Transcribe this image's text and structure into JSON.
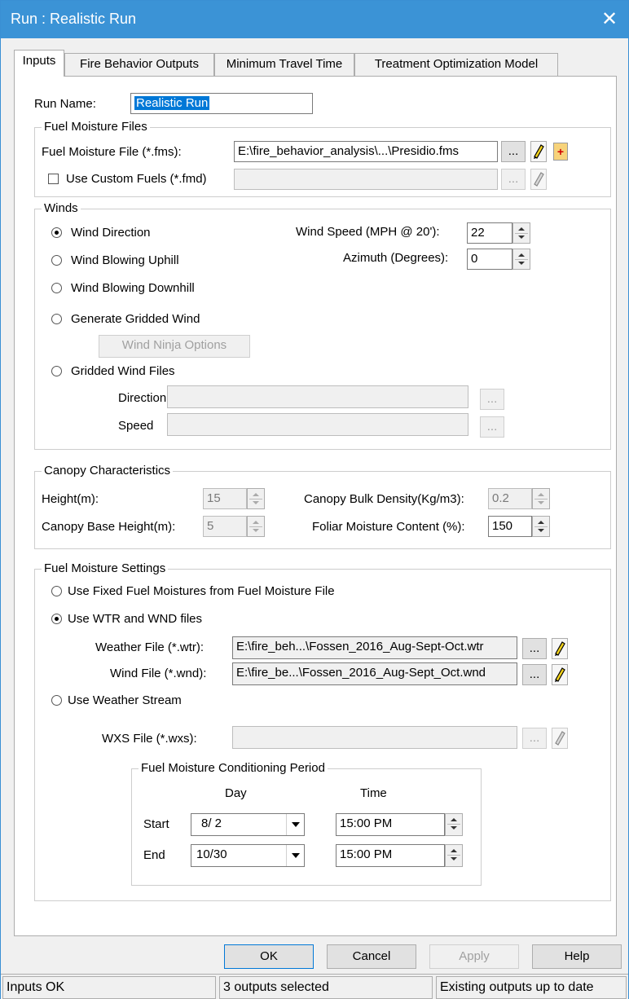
{
  "window": {
    "title": "Run : Realistic Run",
    "close_glyph": "✕"
  },
  "tabs": [
    "Inputs",
    "Fire Behavior Outputs",
    "Minimum Travel Time",
    "Treatment Optimization Model"
  ],
  "run_name": {
    "label": "Run Name:",
    "value": "Realistic Run"
  },
  "fuel_moisture_files": {
    "legend": "Fuel Moisture Files",
    "fms_label": "Fuel Moisture File (*.fms):",
    "fms_value": "E:\\fire_behavior_analysis\\...\\Presidio.fms",
    "custom_label": "Use Custom Fuels (*.fmd)",
    "custom_checked": false,
    "custom_value": "",
    "browse": "..."
  },
  "winds": {
    "legend": "Winds",
    "options": [
      "Wind Direction",
      "Wind Blowing Uphill",
      "Wind Blowing Downhill",
      "Generate Gridded Wind",
      "Gridded Wind Files"
    ],
    "selected": "Wind Direction",
    "speed_label": "Wind Speed (MPH @ 20'):",
    "speed_value": "22",
    "azimuth_label": "Azimuth (Degrees):",
    "azimuth_value": "0",
    "ninja_button": "Wind Ninja Options",
    "direction_label": "Direction",
    "speed_file_label": "Speed",
    "direction_value": "",
    "speed_file_value": ""
  },
  "canopy": {
    "legend": "Canopy Characteristics",
    "height_label": "Height(m):",
    "height_value": "15",
    "base_label": "Canopy Base Height(m):",
    "base_value": "5",
    "density_label": "Canopy Bulk Density(Kg/m3):",
    "density_value": "0.2",
    "foliar_label": "Foliar Moisture Content (%):",
    "foliar_value": "150"
  },
  "fuel_moisture_settings": {
    "legend": "Fuel Moisture Settings",
    "options": [
      "Use Fixed Fuel Moistures from Fuel Moisture File",
      "Use WTR and WND files",
      "Use Weather Stream"
    ],
    "selected": "Use WTR and WND files",
    "wtr_label": "Weather File (*.wtr):",
    "wtr_value": "E:\\fire_beh...\\Fossen_2016_Aug-Sept-Oct.wtr",
    "wnd_label": "Wind File (*.wnd):",
    "wnd_value": "E:\\fire_be...\\Fossen_2016_Aug-Sept_Oct.wnd",
    "wxs_label": "WXS File (*.wxs):",
    "wxs_value": "",
    "conditioning": {
      "legend": "Fuel Moisture Conditioning Period",
      "day_header": "Day",
      "time_header": "Time",
      "start_label": "Start",
      "end_label": "End",
      "start_day": "8/ 2",
      "end_day": "10/30",
      "start_time": "15:00 PM",
      "end_time": "15:00 PM"
    }
  },
  "buttons": {
    "ok": "OK",
    "cancel": "Cancel",
    "apply": "Apply",
    "help": "Help"
  },
  "status": [
    "Inputs OK",
    "3 outputs selected",
    "Existing outputs up to date"
  ],
  "colors": {
    "titlebar": "#3b93d6",
    "selection": "#0078d7",
    "pencil_yellow": "#f2d21b"
  },
  "icons": {
    "browse": "ellipsis-icon",
    "edit": "pencil-icon",
    "new": "plus-icon",
    "close": "close-icon"
  }
}
